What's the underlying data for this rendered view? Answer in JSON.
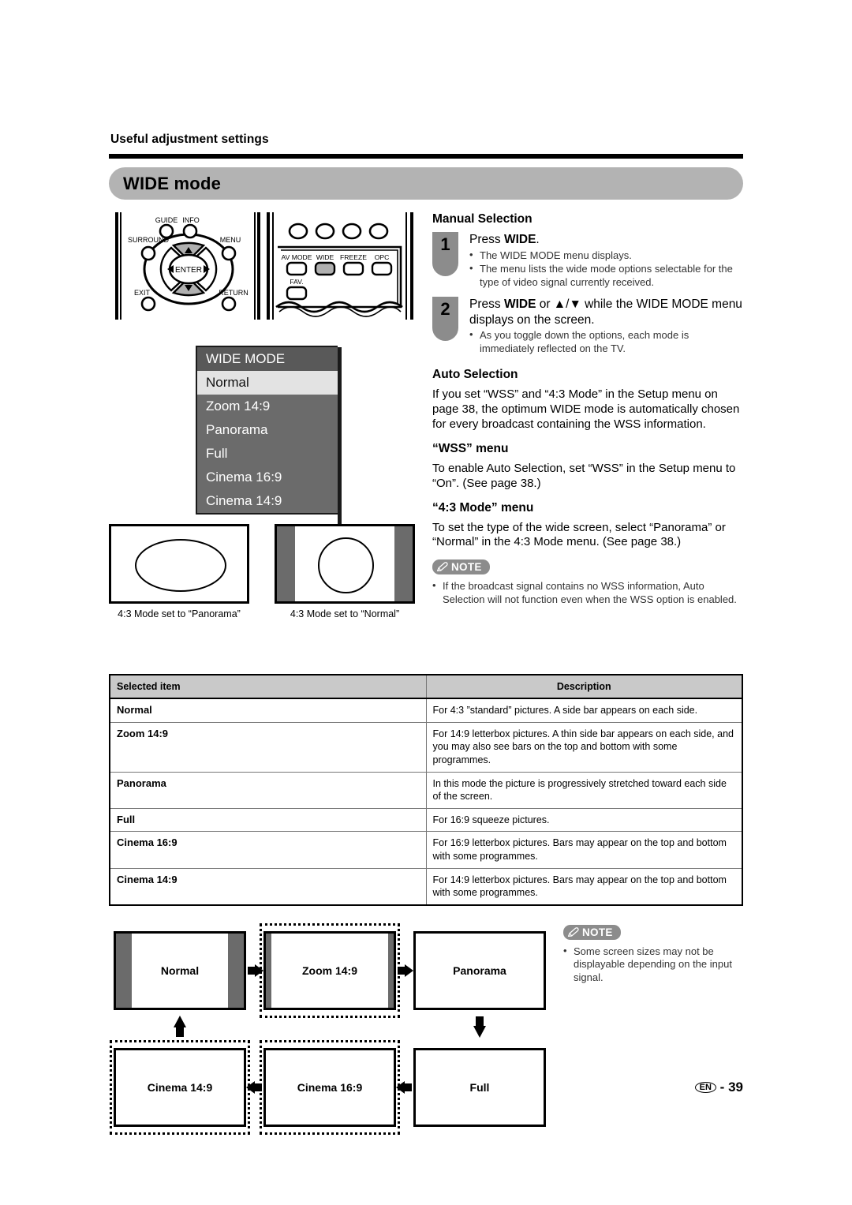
{
  "header": {
    "chapter_title": "Useful adjustment settings",
    "section_title": "WIDE mode"
  },
  "remote": {
    "labels": {
      "guide": "GUIDE",
      "info": "INFO",
      "surround": "SURROUND",
      "menu": "MENU",
      "enter": "ENTER",
      "exit": "EXIT",
      "return": "RETURN",
      "av_mode": "AV MODE",
      "wide": "WIDE",
      "freeze": "FREEZE",
      "opc": "OPC",
      "fav": "FAV."
    }
  },
  "osd": {
    "title": "WIDE MODE",
    "items": [
      {
        "label": "Normal",
        "selected": true
      },
      {
        "label": "Zoom 14:9",
        "selected": false
      },
      {
        "label": "Panorama",
        "selected": false
      },
      {
        "label": "Full",
        "selected": false
      },
      {
        "label": "Cinema 16:9",
        "selected": false
      },
      {
        "label": "Cinema 14:9",
        "selected": false
      }
    ]
  },
  "samples": [
    {
      "caption": "4:3 Mode set to “Panorama”"
    },
    {
      "caption": "4:3 Mode set to “Normal”"
    }
  ],
  "manual_selection": {
    "heading": "Manual Selection",
    "steps": [
      {
        "number": "1",
        "text_pre": "Press ",
        "text_bold": "WIDE",
        "text_post": ".",
        "bullets": [
          "The WIDE MODE menu displays.",
          "The menu lists the wide mode options selectable for the type of video signal currently received."
        ]
      },
      {
        "number": "2",
        "text_pre": "Press ",
        "text_bold": "WIDE",
        "text_post": " or ▲/▼ while the WIDE MODE menu displays on the screen.",
        "bullets": [
          "As you toggle down the options, each mode is immediately reflected on the TV."
        ]
      }
    ]
  },
  "auto_selection": {
    "heading": "Auto Selection",
    "body": "If you set “WSS” and “4:3 Mode” in the Setup menu on page 38, the optimum WIDE mode is automatically chosen for every broadcast containing the WSS information.",
    "wss": {
      "heading": "“WSS” menu",
      "body": "To enable Auto Selection, set “WSS” in the Setup menu to “On”. (See page 38.)"
    },
    "mode43": {
      "heading": "“4:3 Mode” menu",
      "body": "To set the type of the wide screen, select “Panorama” or “Normal” in the 4:3 Mode menu. (See page 38.)"
    }
  },
  "note_top": {
    "label": "NOTE",
    "items": [
      "If the broadcast signal contains no WSS information, Auto Selection will not function even when the WSS option is enabled."
    ]
  },
  "note_flow": {
    "label": "NOTE",
    "items": [
      "Some screen sizes may not be displayable depending on the input signal."
    ]
  },
  "table": {
    "headers": [
      "Selected item",
      "Description"
    ],
    "rows": [
      {
        "item": "Normal",
        "desc": "For 4:3 ”standard” pictures. A side bar appears on each side."
      },
      {
        "item": "Zoom 14:9",
        "desc": "For 14:9 letterbox pictures. A thin side bar appears on each side, and you may also see bars on the top and bottom with some programmes."
      },
      {
        "item": "Panorama",
        "desc": "In this mode the picture is progressively stretched toward each side of the screen."
      },
      {
        "item": "Full",
        "desc": "For 16:9 squeeze pictures."
      },
      {
        "item": "Cinema 16:9",
        "desc": "For 16:9 letterbox pictures. Bars may appear on the top and bottom with some programmes."
      },
      {
        "item": "Cinema 14:9",
        "desc": "For 14:9 letterbox pictures. Bars may appear on the top and bottom with some programmes."
      }
    ]
  },
  "flow": {
    "boxes": [
      {
        "label": "Normal"
      },
      {
        "label": "Zoom 14:9"
      },
      {
        "label": "Panorama"
      },
      {
        "label": "Cinema 14:9"
      },
      {
        "label": "Cinema 16:9"
      },
      {
        "label": "Full"
      }
    ]
  },
  "footer": {
    "locale": "EN",
    "separator": "-",
    "page": "39"
  },
  "colors": {
    "banner_gray": "#b3b3b3",
    "osd_bg": "#6b6b6b",
    "osd_title_bg": "#595959",
    "osd_selected_bg": "#e3e3e3",
    "badge_gray": "#8c8c8c",
    "table_header_gray": "#c9c9c9"
  }
}
